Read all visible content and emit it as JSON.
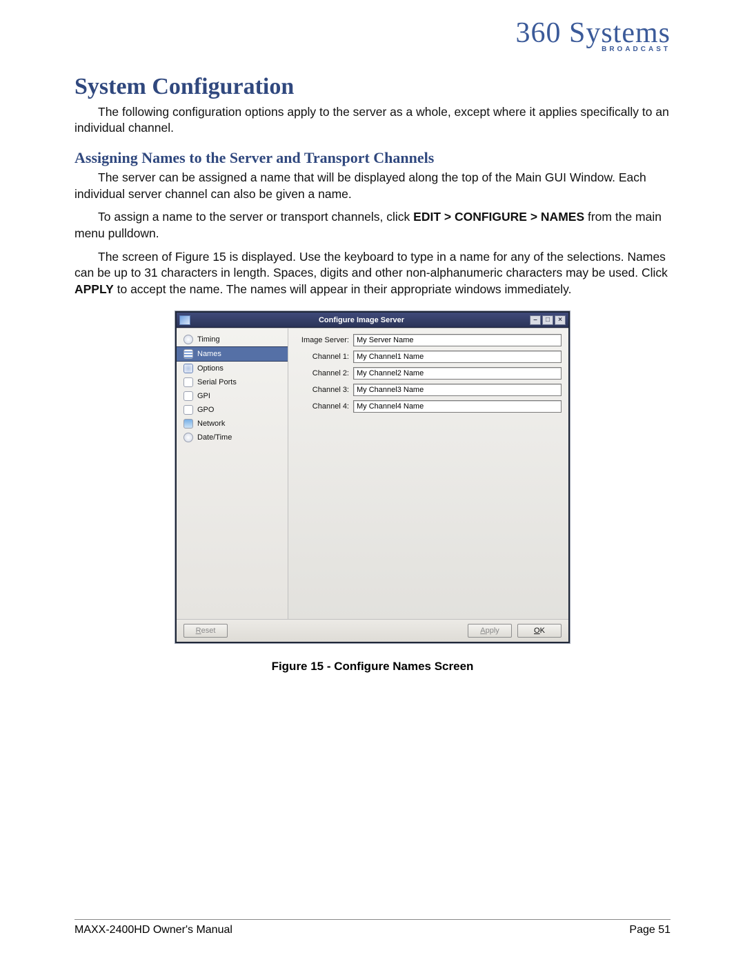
{
  "logo": {
    "script": "360 Systems",
    "subtitle": "BROADCAST"
  },
  "h1": "System Configuration",
  "p1": "The following configuration options apply to the server as a whole, except where it applies specifically to an individual channel.",
  "h2": "Assigning Names to the Server and Transport Channels",
  "p2": "The server can be assigned a name that will be displayed along the top of the Main GUI Window. Each individual server channel can also be given a name.",
  "p3a": "To assign a name to the server or transport channels, click ",
  "p3b": "EDIT > CONFIGURE > NAMES",
  "p3c": " from the main menu pulldown.",
  "p4a": "The screen of Figure 15 is displayed. Use the keyboard to type in a name for any of the selections. Names can be up to 31 characters in length. Spaces, digits and other non-alphanumeric characters may be used. Click ",
  "p4b": "APPLY",
  "p4c": " to accept the name. The names will appear in their appropriate windows immediately.",
  "figcaption": "Figure 15 - Configure Names Screen",
  "footer_left": "MAXX-2400HD Owner's Manual",
  "footer_right": "Page 51",
  "dlg": {
    "title": "Configure Image Server",
    "side": {
      "i0": "Timing",
      "i1": "Names",
      "i2": "Options",
      "i3": "Serial Ports",
      "i4": "GPI",
      "i5": "GPO",
      "i6": "Network",
      "i7": "Date/Time"
    },
    "fields": {
      "l0": "Image Server:",
      "v0": "My Server Name",
      "l1": "Channel 1:",
      "v1": "My Channel1 Name",
      "l2": "Channel 2:",
      "v2": "My Channel2 Name",
      "l3": "Channel 3:",
      "v3": "My Channel3 Name",
      "l4": "Channel 4:",
      "v4": "My Channel4 Name"
    },
    "btn_reset_u": "R",
    "btn_reset_rest": "eset",
    "btn_apply_u": "A",
    "btn_apply_rest": "pply",
    "btn_ok_u": "O",
    "btn_ok_rest": "K",
    "tb_min": "–",
    "tb_max": "□",
    "tb_close": "×"
  }
}
